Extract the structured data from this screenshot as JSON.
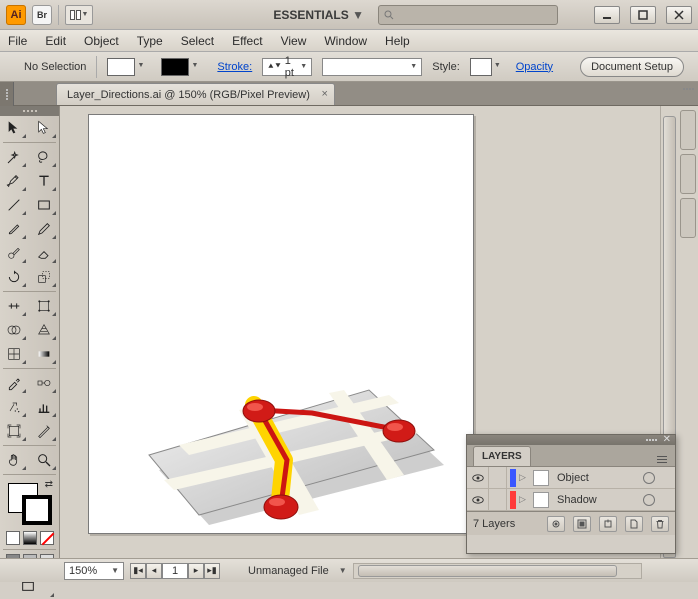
{
  "titlebar": {
    "app_badge": "Ai",
    "bridge_badge": "Br",
    "workspace": "ESSENTIALS",
    "search_placeholder": ""
  },
  "menu": {
    "items": [
      "File",
      "Edit",
      "Object",
      "Type",
      "Select",
      "Effect",
      "View",
      "Window",
      "Help"
    ]
  },
  "options": {
    "selection": "No Selection",
    "stroke_label": "Stroke:",
    "stroke_value": "1 pt",
    "style_label": "Style:",
    "opacity_label": "Opacity",
    "doc_setup": "Document Setup"
  },
  "document": {
    "tab_title": "Layer_Directions.ai @ 150% (RGB/Pixel Preview)"
  },
  "status": {
    "zoom": "150%",
    "page": "1",
    "file_status": "Unmanaged File"
  },
  "layers": {
    "title": "LAYERS",
    "rows": [
      {
        "name": "Object",
        "color": "#3a57ff"
      },
      {
        "name": "Shadow",
        "color": "#ff3a3a"
      }
    ],
    "count": "7 Layers"
  },
  "tools": [
    "selection-tool",
    "direct-selection-tool",
    "magic-wand-tool",
    "lasso-tool",
    "pen-tool",
    "type-tool",
    "line-tool",
    "rectangle-tool",
    "paintbrush-tool",
    "pencil-tool",
    "blob-brush-tool",
    "eraser-tool",
    "rotate-tool",
    "scale-tool",
    "width-tool",
    "free-transform-tool",
    "shape-builder-tool",
    "perspective-tool",
    "mesh-tool",
    "gradient-tool",
    "eyedropper-tool",
    "blend-tool",
    "symbol-sprayer-tool",
    "graph-tool",
    "artboard-tool",
    "slice-tool",
    "hand-tool",
    "zoom-tool"
  ]
}
